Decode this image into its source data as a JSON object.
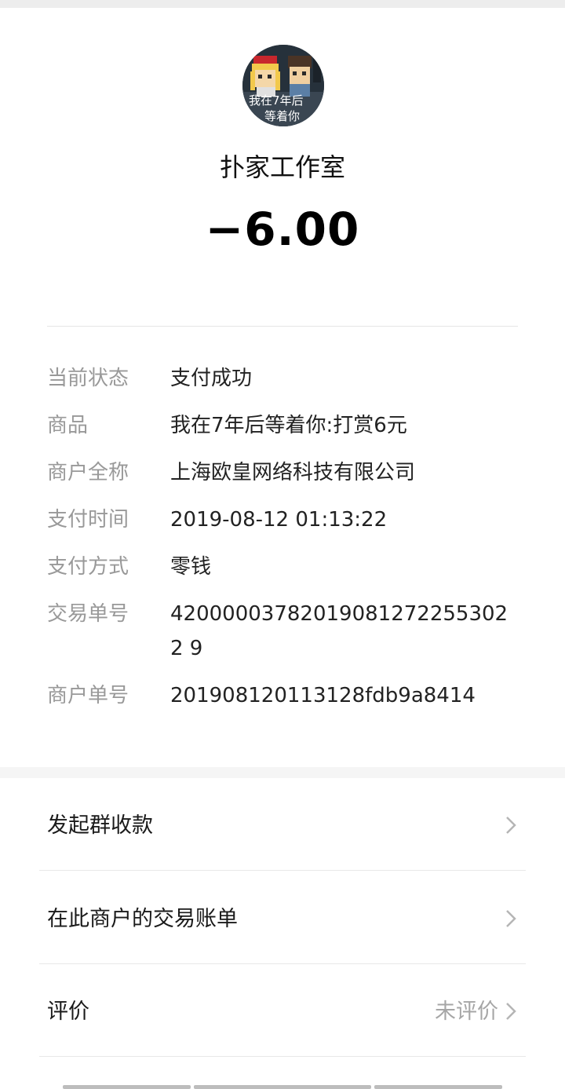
{
  "header": {
    "avatar_text_line1": "我在7年后",
    "avatar_text_line2": "等着你",
    "merchant_name": "扑家工作室",
    "amount": "−6.00"
  },
  "details": [
    {
      "label": "当前状态",
      "value": "支付成功"
    },
    {
      "label": "商品",
      "value": "我在7年后等着你:打赏6元"
    },
    {
      "label": "商户全称",
      "value": "上海欧皇网络科技有限公司"
    },
    {
      "label": "支付时间",
      "value": "2019-08-12 01:13:22"
    },
    {
      "label": "支付方式",
      "value": "零钱"
    },
    {
      "label": "交易单号",
      "value": "420000037820190812722553022 9"
    },
    {
      "label": "商户单号",
      "value": "201908120113128fdb9a8414"
    }
  ],
  "actions": [
    {
      "label": "发起群收款",
      "right": ""
    },
    {
      "label": "在此商户的交易账单",
      "right": ""
    },
    {
      "label": "评价",
      "right": "未评价"
    }
  ],
  "icons": {
    "chevron": "chevron-right-icon"
  },
  "colors": {
    "label_gray": "#999999",
    "divider": "#e6e6e6"
  }
}
